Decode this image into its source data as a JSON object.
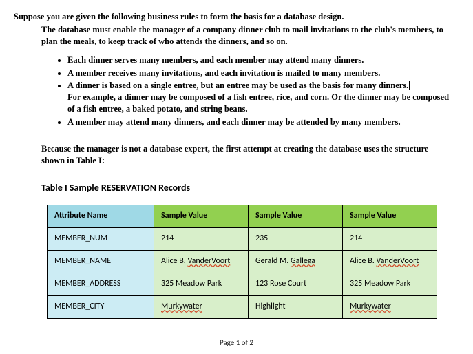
{
  "heading": {
    "main": "Suppose you are given the following business rules to form the basis for a database design.",
    "sub": "The database must enable the manager of a company dinner club to mail invitations to the club's members, to plan the meals, to keep track of who attends the dinners, and so on."
  },
  "rules": [
    "Each dinner serves many members, and each member may attend many dinners.",
    "A member receives many invitations, and each invitation is mailed to many members.",
    "A dinner is based on a single entree, but an entree may be used as the basis for many dinners.",
    "For example, a dinner may be composed of a fish entree, rice, and corn. Or the dinner may be composed of a fish entree, a baked potato, and string beans.",
    "A member may attend many dinners, and each dinner may be attended by many members."
  ],
  "paragraph": "Because the manager is not a database expert, the first attempt at creating the database uses the structure shown in Table I:",
  "table_title": "Table I Sample RESERVATION Records",
  "table": {
    "header": [
      "Attribute Name",
      "Sample Value",
      "Sample Value",
      "Sample Value"
    ],
    "rows": [
      {
        "attr": "MEMBER_NUM",
        "v1": "214",
        "v2": "235",
        "v3": "214"
      },
      {
        "attr": "MEMBER_NAME",
        "v1": "Alice B. VanderVoort",
        "v2": "Gerald M. Gallega",
        "v3": "Alice B. VanderVoort"
      },
      {
        "attr": "MEMBER_ADDRESS",
        "v1": "325 Meadow Park",
        "v2": "123 Rose Court",
        "v3": "325 Meadow Park"
      },
      {
        "attr": "MEMBER_CITY",
        "v1": "Murkywater",
        "v2": "Highlight",
        "v3": "Murkywater"
      }
    ]
  },
  "footer": "Page 1 of 2"
}
